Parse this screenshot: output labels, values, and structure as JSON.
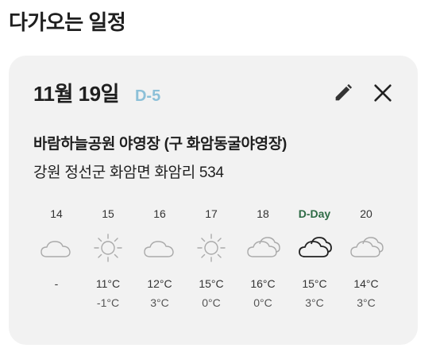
{
  "section_title": "다가오는 일정",
  "event": {
    "date": "11월 19일",
    "dday": "D-5",
    "place_name": "바람하늘공원 야영장 (구 화암동굴야영장)",
    "address": "강원 정선군 화암면 화암리 534",
    "actions": {
      "edit_icon": "pencil-icon",
      "close_icon": "close-icon"
    }
  },
  "forecast": [
    {
      "day": "14",
      "icon": "cloud-icon",
      "icon_color": "#aaaaaa",
      "high": "-",
      "low": ""
    },
    {
      "day": "15",
      "icon": "sun-icon",
      "icon_color": "#aaaaaa",
      "high": "11°C",
      "low": "-1°C"
    },
    {
      "day": "16",
      "icon": "cloud-icon",
      "icon_color": "#aaaaaa",
      "high": "12°C",
      "low": "3°C"
    },
    {
      "day": "17",
      "icon": "sun-icon",
      "icon_color": "#aaaaaa",
      "high": "15°C",
      "low": "0°C"
    },
    {
      "day": "18",
      "icon": "double-cloud-icon",
      "icon_color": "#aaaaaa",
      "high": "16°C",
      "low": "0°C"
    },
    {
      "day": "D-Day",
      "icon": "double-cloud-icon",
      "icon_color": "#222222",
      "high": "15°C",
      "low": "3°C",
      "highlight": true
    },
    {
      "day": "20",
      "icon": "double-cloud-icon",
      "icon_color": "#aaaaaa",
      "high": "14°C",
      "low": "3°C"
    }
  ]
}
